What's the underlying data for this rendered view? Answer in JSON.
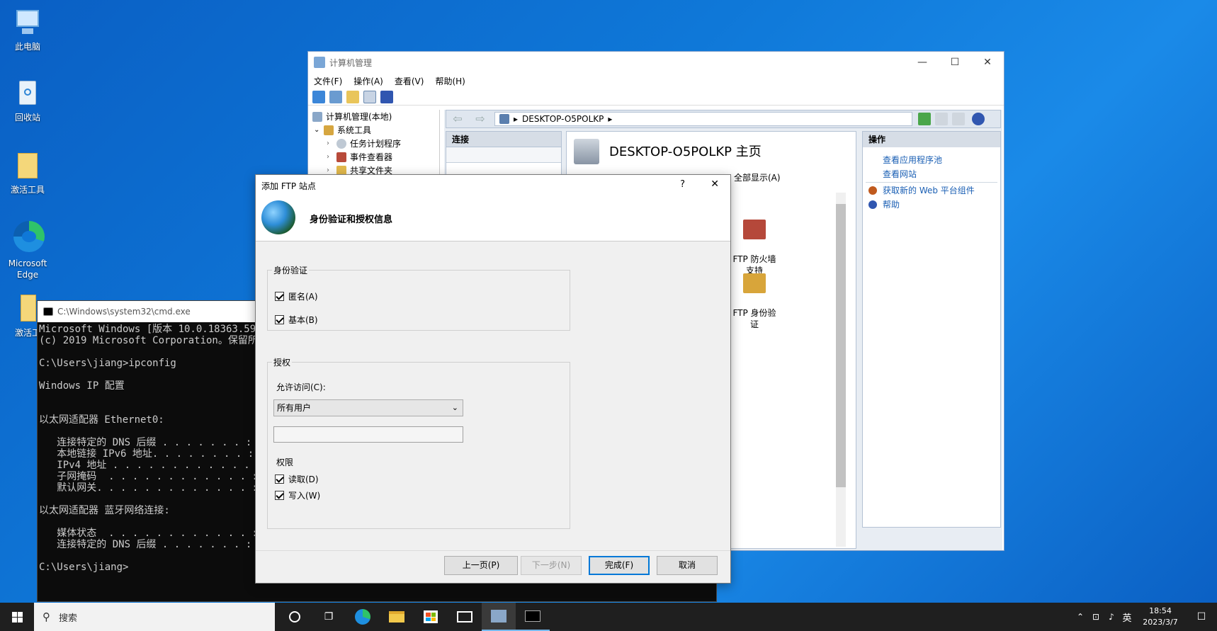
{
  "desktop": {
    "icons": [
      {
        "label": "此电脑"
      },
      {
        "label": "回收站"
      },
      {
        "label": "激活工具"
      },
      {
        "label": "Microsoft Edge"
      },
      {
        "label": "激活工"
      }
    ]
  },
  "computer_management": {
    "title": "计算机管理",
    "menu": [
      "文件(F)",
      "操作(A)",
      "查看(V)",
      "帮助(H)"
    ],
    "tree": [
      {
        "label": "计算机管理(本地)"
      },
      {
        "label": "系统工具"
      },
      {
        "label": "任务计划程序"
      },
      {
        "label": "事件查看器"
      },
      {
        "label": "共享文件夹"
      }
    ],
    "address": {
      "segment": "DESKTOP-O5POLKP"
    },
    "connections_header": "连接",
    "home_title": "DESKTOP-O5POLKP 主页",
    "show_all": "全部显示(A)",
    "features": [
      {
        "label": "FTP 防火墙\n支持"
      },
      {
        "label": "FTP 身份验\n证"
      }
    ],
    "actions_header": "操作",
    "actions": [
      "查看应用程序池",
      "查看网站",
      "获取新的 Web 平台组件",
      "帮助"
    ]
  },
  "cmd": {
    "title": "C:\\Windows\\system32\\cmd.exe",
    "lines": [
      "Microsoft Windows [版本 10.0.18363.592]",
      "(c) 2019 Microsoft Corporation。保留所有权利。",
      "",
      "C:\\Users\\jiang>ipconfig",
      "",
      "Windows IP 配置",
      "",
      "",
      "以太网适配器 Ethernet0:",
      "",
      "   连接特定的 DNS 后缀 . . . . . . . :",
      "   本地链接 IPv6 地址. . . . . . . . :",
      "   IPv4 地址 . . . . . . . . . . . . :",
      "   子网掩码  . . . . . . . . . . . . :",
      "   默认网关. . . . . . . . . . . . . :",
      "",
      "以太网适配器 蓝牙网络连接:",
      "",
      "   媒体状态  . . . . . . . . . . . . :",
      "   连接特定的 DNS 后缀 . . . . . . . :",
      "",
      "C:\\Users\\jiang>"
    ]
  },
  "dialog": {
    "title": "添加 FTP 站点",
    "help": "?",
    "close": "✕",
    "header": "身份验证和授权信息",
    "auth_group": "身份验证",
    "anonymous": "匿名(A)",
    "basic": "基本(B)",
    "authz_group": "授权",
    "allow_access_label": "允许访问(C):",
    "allow_access_value": "所有用户",
    "permissions_label": "权限",
    "read": "读取(D)",
    "write": "写入(W)",
    "buttons": {
      "prev": "上一页(P)",
      "next": "下一步(N)",
      "finish": "完成(F)",
      "cancel": "取消"
    }
  },
  "taskbar": {
    "search_placeholder": "搜索",
    "ime": "英",
    "time": "18:54",
    "date": "2023/3/7"
  }
}
